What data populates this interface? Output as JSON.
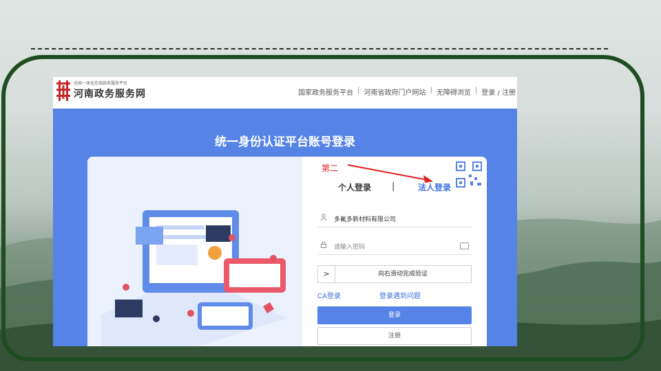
{
  "site": {
    "logo_small": "全国一体化在线政务服务平台",
    "logo_main": "河南政务服务网"
  },
  "nav": {
    "items": [
      "国家政务服务平台",
      "河南省政府门户网站",
      "无障碍浏览"
    ],
    "login_register": "登录 / 注册"
  },
  "page": {
    "title": "统一身份认证平台账号登录"
  },
  "tabs": {
    "personal": "个人登录",
    "legal": "法人登录"
  },
  "annotation": {
    "text": "第二"
  },
  "form": {
    "company_value": "多氟多新材料有限公司",
    "password_placeholder": "请输入密码",
    "slider_text": "向右滑动完成验证",
    "slider_arrow": ">",
    "ca_login": "CA登录",
    "problem_link": "登录遇到问题",
    "login_button": "登录",
    "register_button": "注册"
  },
  "colors": {
    "brand_blue": "#5583e6",
    "link_blue": "#3d6fdc",
    "annotation_red": "#e02020",
    "frame_green": "#1f4d22"
  }
}
